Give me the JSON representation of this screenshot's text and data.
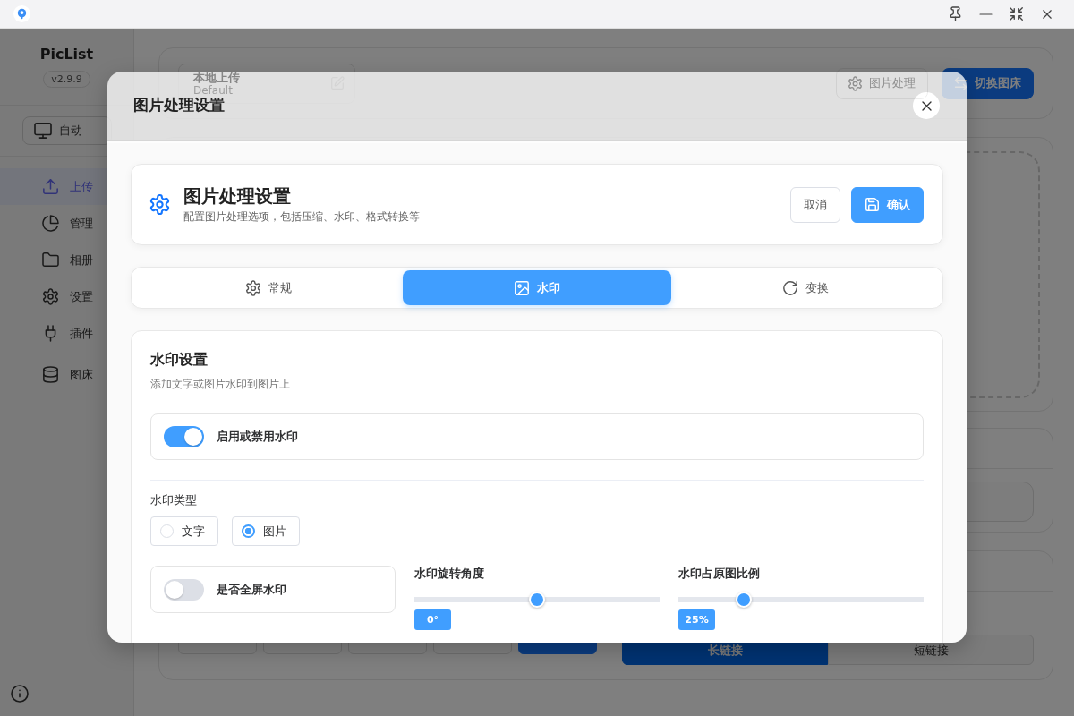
{
  "sidebar": {
    "app_name": "PicList",
    "version": "v2.9.9",
    "theme_button": "自动",
    "items": [
      {
        "label": "上传",
        "selected": true
      },
      {
        "label": "管理",
        "selected": false
      },
      {
        "label": "相册",
        "selected": false
      },
      {
        "label": "设置",
        "selected": false
      },
      {
        "label": "插件",
        "selected": false
      },
      {
        "label": "图床",
        "selected": false
      }
    ]
  },
  "main": {
    "uploader": {
      "name": "本地上传",
      "config": "Default"
    },
    "actions": [
      {
        "label": "图片处理",
        "kind": "outline"
      },
      {
        "label": "切换图床",
        "kind": "primary"
      }
    ],
    "format_buttons": [
      {
        "selected": false
      },
      {
        "selected": false
      },
      {
        "selected": false
      },
      {
        "selected": false
      },
      {
        "selected": true
      }
    ],
    "link_types": [
      {
        "label": "长链接",
        "selected": true
      },
      {
        "label": "短链接",
        "selected": false
      }
    ]
  },
  "dialog": {
    "title": "图片处理设置",
    "header": {
      "title": "图片处理设置",
      "subtitle": "配置图片处理选项，包括压缩、水印、格式转换等",
      "buttons": [
        {
          "label": "取消",
          "kind": "secondary"
        },
        {
          "label": "确认",
          "kind": "primary"
        }
      ]
    },
    "tabs": [
      {
        "label": "常规",
        "selected": false
      },
      {
        "label": "水印",
        "selected": true
      },
      {
        "label": "变换",
        "selected": false
      }
    ],
    "section": {
      "title": "水印设置",
      "subtitle": "添加文字或图片水印到图片上",
      "enable": {
        "label": "启用或禁用水印",
        "on": true
      },
      "type": {
        "label": "水印类型",
        "options": [
          {
            "label": "文字",
            "selected": false
          },
          {
            "label": "图片",
            "selected": true
          }
        ]
      },
      "fullscreen": {
        "label": "是否全屏水印",
        "on": false
      },
      "sliders": [
        {
          "label": "水印旋转角度",
          "level": 0.5,
          "reading": "0°"
        },
        {
          "label": "水印占原图比例",
          "level": 0.25,
          "reading": "25%"
        }
      ]
    }
  }
}
